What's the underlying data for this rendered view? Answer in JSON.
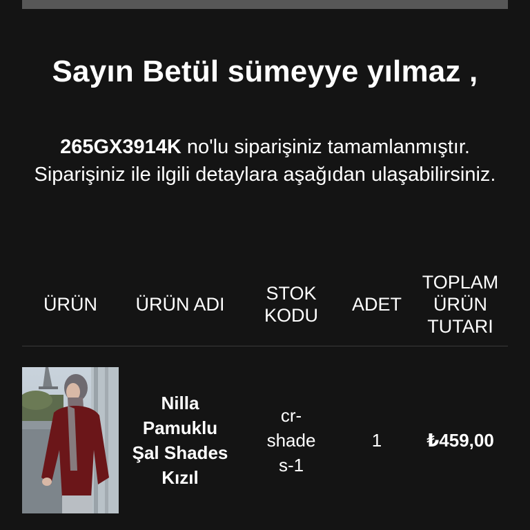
{
  "greeting": "Sayın Betül sümeyye yılmaz ,",
  "message": {
    "order_number": "265GX3914K",
    "text": " no'lu siparişiniz tamamlanmıştır. Siparişiniz ile ilgili detaylara aşağıdan ulaşabilirsiniz."
  },
  "table": {
    "headers": {
      "product": "ÜRÜN",
      "product_name": "ÜRÜN ADI",
      "stock_code": "STOK KODU",
      "quantity": "ADET",
      "total": "TOPLAM ÜRÜN TUTARI"
    },
    "rows": [
      {
        "image_icon": "product-photo",
        "name": "Nilla Pamuklu Şal Shades Kızıl",
        "stock_code": "cr-shades-1",
        "quantity": "1",
        "total": "₺459,00"
      }
    ]
  },
  "colors": {
    "background": "#141414",
    "text": "#ffffff",
    "top_bar": "#575757",
    "divider": "#3a3a3a"
  }
}
